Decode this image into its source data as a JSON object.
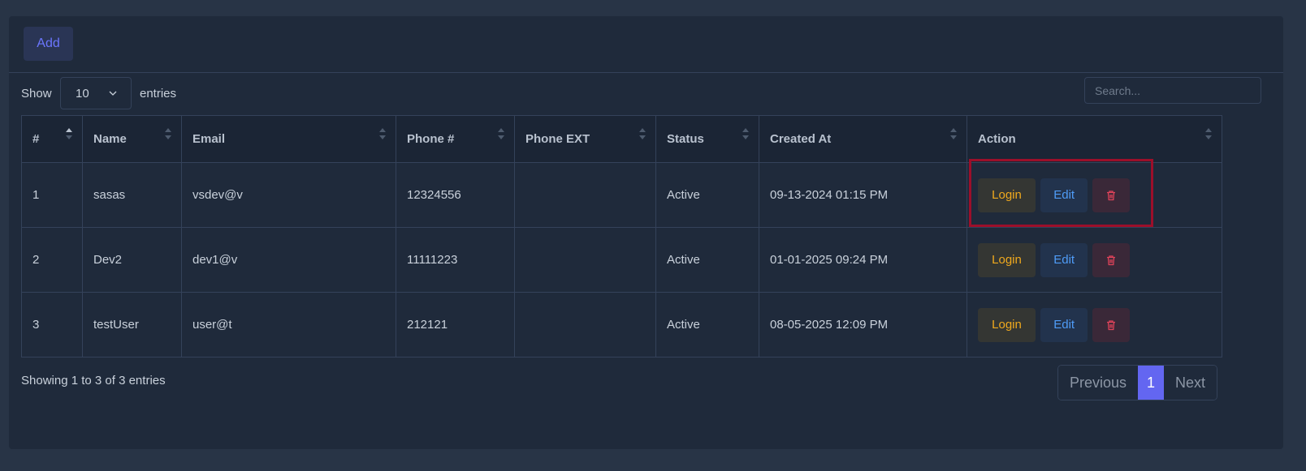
{
  "toolbar": {
    "add_label": "Add"
  },
  "length_control": {
    "show_label": "Show",
    "selected": "10",
    "entries_label": "entries"
  },
  "search": {
    "placeholder": "Search..."
  },
  "table": {
    "columns": [
      "#",
      "Name",
      "Email",
      "Phone #",
      "Phone EXT",
      "Status",
      "Created At",
      "Action"
    ],
    "rows": [
      {
        "num": "1",
        "name": "sasas",
        "email": "vsdev@v",
        "phone": "12324556",
        "ext": "",
        "status": "Active",
        "created": "09-13-2024 01:15 PM"
      },
      {
        "num": "2",
        "name": "Dev2",
        "email": "dev1@v",
        "phone": "11111223",
        "ext": "",
        "status": "Active",
        "created": "01-01-2025 09:24 PM"
      },
      {
        "num": "3",
        "name": "testUser",
        "email": "user@t",
        "phone": "212121",
        "ext": "",
        "status": "Active",
        "created": "08-05-2025 12:09 PM"
      }
    ],
    "actions": {
      "login": "Login",
      "edit": "Edit",
      "delete_icon": "trash-icon"
    }
  },
  "footer": {
    "info": "Showing 1 to 3 of 3 entries"
  },
  "pagination": {
    "previous": "Previous",
    "current": "1",
    "next": "Next"
  },
  "colors": {
    "accent": "#6366f1",
    "login": "#f0a91d",
    "edit": "#4f9cf7",
    "delete": "#e0435a",
    "highlight": "#9c0f2a"
  }
}
